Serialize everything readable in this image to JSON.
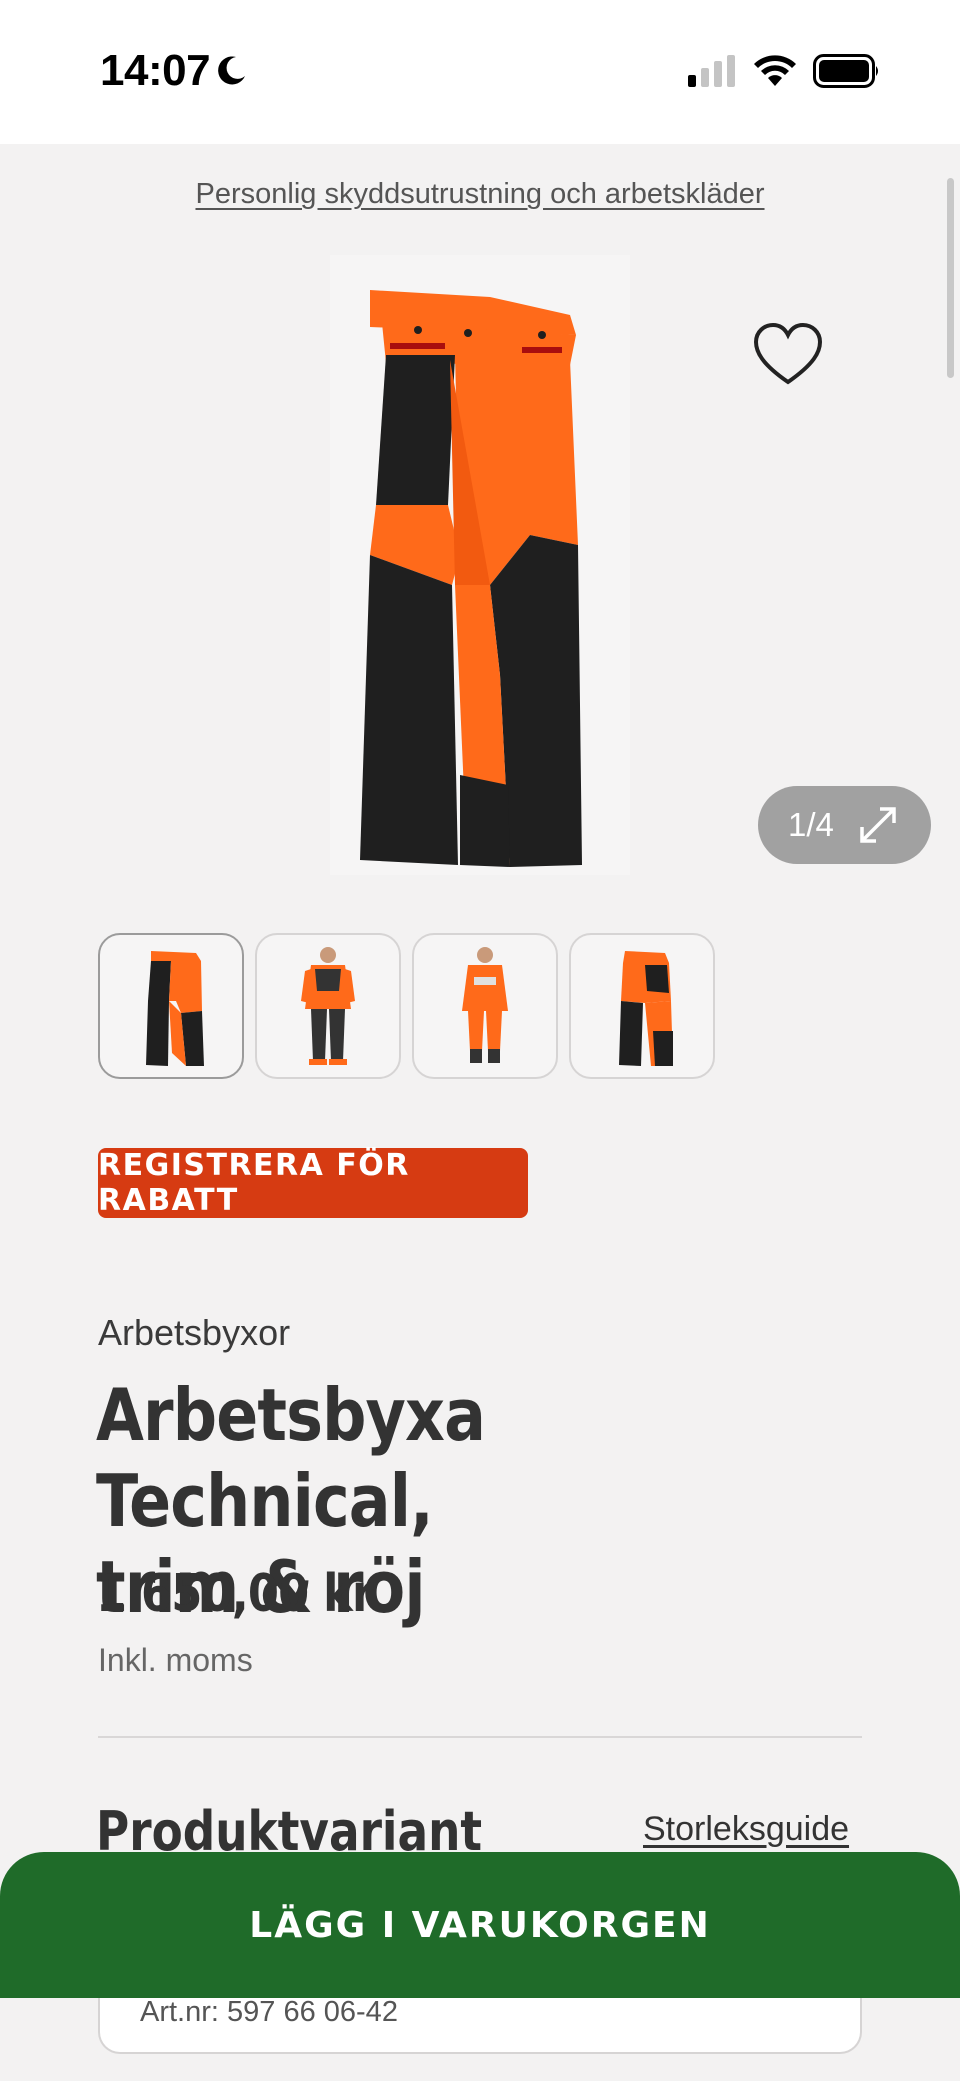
{
  "status_bar": {
    "time": "14:07",
    "icons": [
      "moon-icon",
      "cellular-signal-icon",
      "wifi-icon",
      "battery-icon"
    ]
  },
  "breadcrumb": "Personlig skyddsutrustning och arbetskläder",
  "gallery": {
    "counter": "1/4",
    "thumbnails": [
      "Front view",
      "Worn front",
      "Worn back",
      "Back view"
    ],
    "active_index": 0
  },
  "promo_label": "REGISTRERA FÖR RABATT",
  "product": {
    "category": "Arbetsbyxor",
    "title": "Arbetsbyxa Technical, trim & röj",
    "price": "1 650,00 kr",
    "vat_note": "Inkl. moms"
  },
  "variant_section": {
    "title": "Produktvariant",
    "size_guide_link": "Storleksguide",
    "art_nr": "Art.nr: 597 66 06-42"
  },
  "cart_button": "LÄGG I VARUKORGEN",
  "colors": {
    "brand_orange": "#d63b12",
    "cart_green": "#1f6b29",
    "pants_orange": "#ff6a1a",
    "pants_black": "#1f1f1f"
  }
}
